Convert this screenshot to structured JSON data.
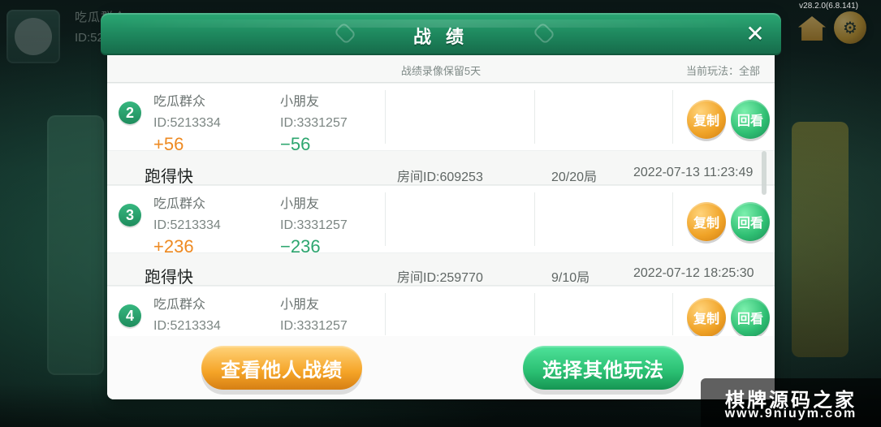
{
  "background": {
    "player_name": "吃瓜群众",
    "player_id": "ID:5213334",
    "version": "v28.2.0(6.8.141)"
  },
  "dialog": {
    "title": "战 绩",
    "close_glyph": "✕",
    "subbar": {
      "center": "战绩录像保留5天",
      "right": "当前玩法：全部"
    },
    "matches": [
      {
        "game": "",
        "room_id": "",
        "rounds": "",
        "time": "",
        "rank": "2",
        "players": [
          {
            "name": "吃瓜群众",
            "id": "ID:5213334",
            "score": "+56"
          },
          {
            "name": "小朋友",
            "id": "ID:3331257",
            "score": "−56"
          }
        ],
        "buttons": {
          "copy": "复制",
          "replay": "回看"
        }
      },
      {
        "game": "跑得快",
        "room_id": "房间ID:609253",
        "rounds": "20/20局",
        "time": "2022-07-13 11:23:49",
        "rank": "3",
        "players": [
          {
            "name": "吃瓜群众",
            "id": "ID:5213334",
            "score": "+236"
          },
          {
            "name": "小朋友",
            "id": "ID:3331257",
            "score": "−236"
          }
        ],
        "buttons": {
          "copy": "复制",
          "replay": "回看"
        }
      },
      {
        "game": "跑得快",
        "room_id": "房间ID:259770",
        "rounds": "9/10局",
        "time": "2022-07-12 18:25:30",
        "rank": "4",
        "players": [
          {
            "name": "吃瓜群众",
            "id": "ID:5213334",
            "score": ""
          },
          {
            "name": "小朋友",
            "id": "ID:3331257",
            "score": ""
          }
        ],
        "buttons": {
          "copy": "复制",
          "replay": "回看"
        }
      }
    ],
    "bottom_buttons": {
      "left": "查看他人战绩",
      "right": "选择其他玩法"
    }
  },
  "watermark": {
    "line1": "棋牌源码之家",
    "line2": "www.9niuym.com"
  },
  "colors": {
    "header_green": "#1e7f59",
    "plus_orange": "#ee8a22",
    "minus_green": "#2da66f"
  }
}
